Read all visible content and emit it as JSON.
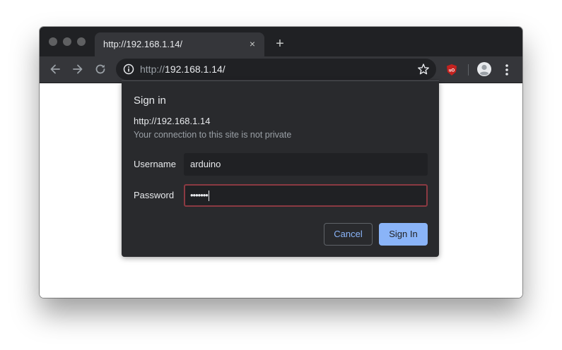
{
  "tab": {
    "title": "http://192.168.1.14/",
    "close_glyph": "×",
    "new_tab_glyph": "+"
  },
  "toolbar": {
    "back_icon": "arrow-left-icon",
    "forward_icon": "arrow-right-icon",
    "reload_icon": "reload-icon",
    "url_scheme": "http://",
    "url_host": "192.168.1.14/",
    "info_icon": "info-icon",
    "bookmark_icon": "star-icon",
    "extension_icon": "ublock-origin-icon",
    "profile_icon": "avatar-icon",
    "menu_icon": "more-vertical-icon"
  },
  "dialog": {
    "title": "Sign in",
    "origin": "http://192.168.1.14",
    "subtitle": "Your connection to this site is not private",
    "username_label": "Username",
    "username_value": "arduino",
    "password_label": "Password",
    "password_value": "•••••••",
    "cancel_label": "Cancel",
    "signin_label": "Sign In"
  },
  "colors": {
    "frame": "#202124",
    "toolbar": "#35363a",
    "dialog_bg": "#292a2d",
    "accent": "#8ab4f8",
    "focus_border": "#8b3a42",
    "ublock_red": "#c4221f"
  }
}
